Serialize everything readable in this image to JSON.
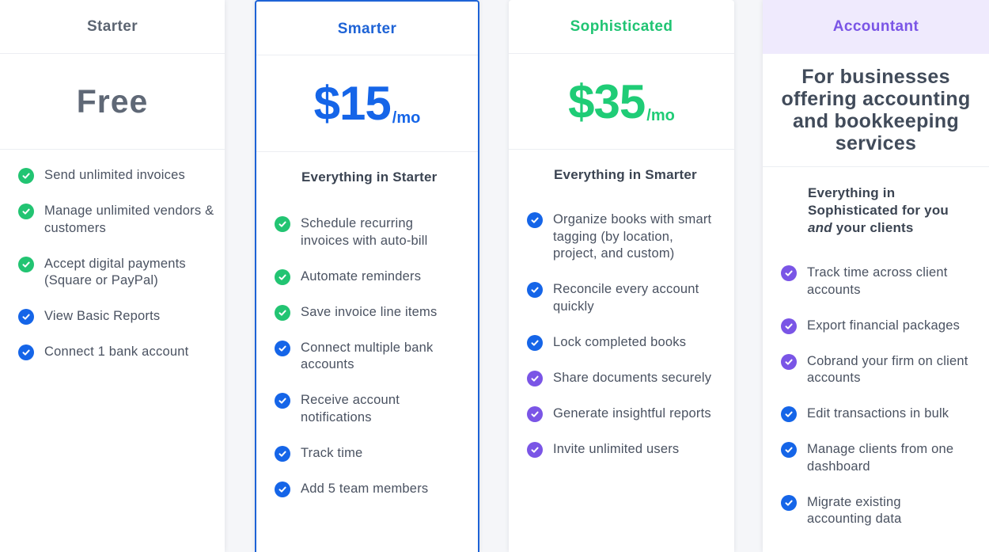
{
  "colors": {
    "green": "#22c472",
    "blue": "#1565e8",
    "purple": "#7a55e6",
    "starter_title": "#5c6572",
    "smarter_title": "#1e63d6",
    "soph_title": "#20c473",
    "acct_title": "#7a55e6"
  },
  "plans": [
    {
      "name": "Starter",
      "price": "Free",
      "features": [
        {
          "text": "Send unlimited invoices",
          "check": "green"
        },
        {
          "text": "Manage unlimited vendors & customers",
          "check": "green"
        },
        {
          "text": "Accept digital payments (Square or PayPal)",
          "check": "green"
        },
        {
          "text": "View Basic Reports",
          "check": "blue"
        },
        {
          "text": "Connect 1 bank account",
          "check": "blue"
        }
      ]
    },
    {
      "name": "Smarter",
      "price": "$15",
      "unit": "/mo",
      "includes": "Everything in Starter",
      "features": [
        {
          "text": "Schedule recurring invoices with auto-bill",
          "check": "green"
        },
        {
          "text": "Automate reminders",
          "check": "green"
        },
        {
          "text": "Save invoice line items",
          "check": "green"
        },
        {
          "text": "Connect multiple bank accounts",
          "check": "blue"
        },
        {
          "text": "Receive account notifications",
          "check": "blue"
        },
        {
          "text": "Track time",
          "check": "blue"
        },
        {
          "text": "Add 5 team members",
          "check": "blue"
        }
      ]
    },
    {
      "name": "Sophisticated",
      "price": "$35",
      "unit": "/mo",
      "includes": "Everything in Smarter",
      "features": [
        {
          "text": "Organize books with smart tagging (by location, project, and custom)",
          "check": "blue"
        },
        {
          "text": "Reconcile every account quickly",
          "check": "blue"
        },
        {
          "text": "Lock completed books",
          "check": "blue"
        },
        {
          "text": "Share documents securely",
          "check": "purple"
        },
        {
          "text": "Generate insightful reports",
          "check": "purple"
        },
        {
          "text": "Invite unlimited users",
          "check": "purple"
        }
      ]
    },
    {
      "name": "Accountant",
      "description": "For businesses offering accounting and bookkeeping services",
      "includes_pre": "Everything in Sophisticated for you ",
      "includes_em": "and",
      "includes_post": " your clients",
      "features": [
        {
          "text": "Track time across client accounts",
          "check": "purple"
        },
        {
          "text": "Export financial packages",
          "check": "purple"
        },
        {
          "text": "Cobrand your firm on client accounts",
          "check": "purple"
        },
        {
          "text": "Edit transactions in bulk",
          "check": "blue"
        },
        {
          "text": "Manage clients from one dashboard",
          "check": "blue"
        },
        {
          "text": "Migrate existing accounting data",
          "check": "blue"
        }
      ]
    }
  ]
}
